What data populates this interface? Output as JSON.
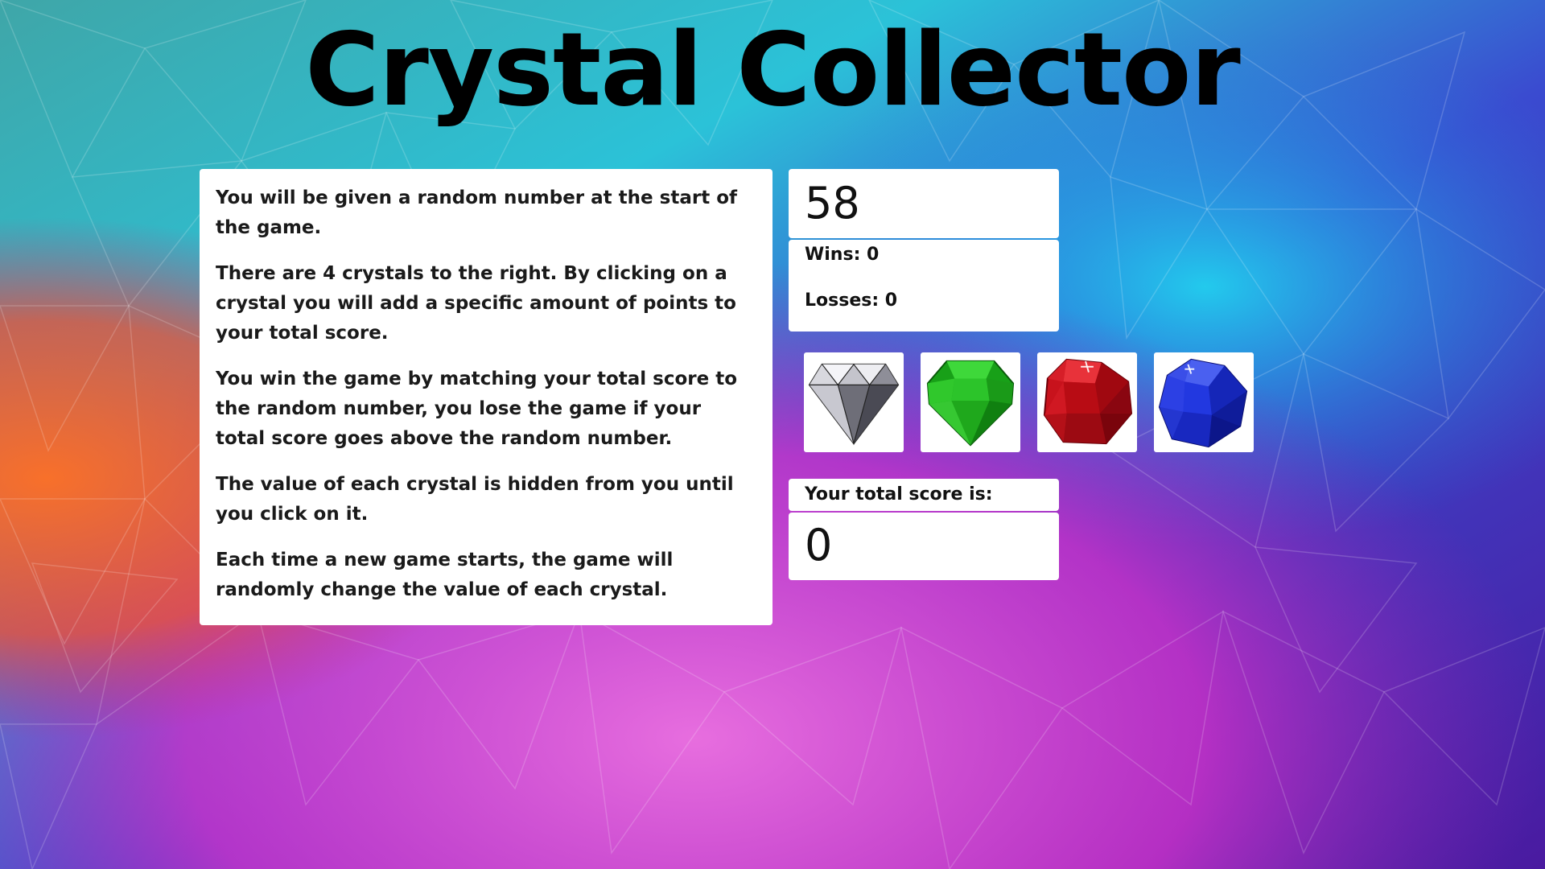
{
  "title": "Crystal Collector",
  "instructions": [
    "You will be given a random number at the start of the game.",
    "There are 4 crystals to the right. By clicking on a crystal you will add a specific amount of points to your total score.",
    "You win the game by matching your total score to the random number, you lose the game if your total score goes above the random number.",
    "The value of each crystal is hidden from you until you click on it.",
    "Each time a new game starts, the game will randomly change the value of each crystal."
  ],
  "target_number": "58",
  "stats": {
    "wins": "Wins: 0",
    "losses": "Losses: 0"
  },
  "crystals": [
    {
      "icon": "diamond-icon",
      "color": "#b8b8c0"
    },
    {
      "icon": "emerald-icon",
      "color": "#22b41f"
    },
    {
      "icon": "ruby-icon",
      "color": "#c8121c"
    },
    {
      "icon": "sapphire-icon",
      "color": "#1e2fd6"
    }
  ],
  "score": {
    "label": "Your total score is:",
    "value": "0"
  },
  "colors": {
    "background_gradient": [
      "#1ec8d8",
      "#3a49c8",
      "#e83ad0",
      "#f0602a"
    ],
    "panel": "#ffffff",
    "text": "#111111"
  }
}
